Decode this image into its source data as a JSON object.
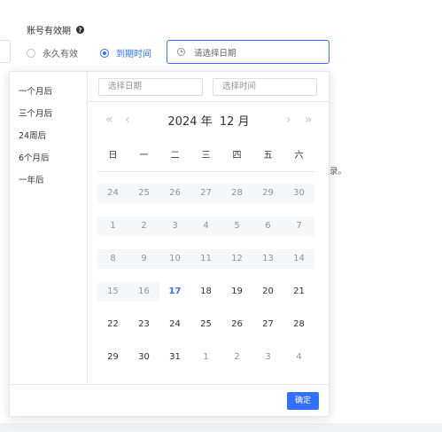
{
  "form": {
    "label": "账号有效期",
    "help_glyph": "?",
    "radio_forever": "永久有效",
    "radio_expiry": "到期时间",
    "date_placeholder": "请选择日期",
    "bg_text": "录。"
  },
  "picker": {
    "shortcuts": [
      "一个月后",
      "三个月后",
      "24周后",
      "6个月后",
      "一年后"
    ],
    "date_placeholder": "选择日期",
    "time_placeholder": "选择时间",
    "nav": {
      "prev_year": "«",
      "prev_month": "‹",
      "next_month": "›",
      "next_year": "»"
    },
    "title_year": "2024 年",
    "title_month": "12 月",
    "weekdays": [
      "日",
      "一",
      "二",
      "三",
      "四",
      "五",
      "六"
    ],
    "weeks": [
      [
        {
          "d": "24",
          "s": "disabled"
        },
        {
          "d": "25",
          "s": "disabled"
        },
        {
          "d": "26",
          "s": "disabled"
        },
        {
          "d": "27",
          "s": "disabled"
        },
        {
          "d": "28",
          "s": "disabled"
        },
        {
          "d": "29",
          "s": "disabled"
        },
        {
          "d": "30",
          "s": "disabled"
        }
      ],
      [
        {
          "d": "1",
          "s": "disabled"
        },
        {
          "d": "2",
          "s": "disabled"
        },
        {
          "d": "3",
          "s": "disabled"
        },
        {
          "d": "4",
          "s": "disabled"
        },
        {
          "d": "5",
          "s": "disabled"
        },
        {
          "d": "6",
          "s": "disabled"
        },
        {
          "d": "7",
          "s": "disabled"
        }
      ],
      [
        {
          "d": "8",
          "s": "disabled"
        },
        {
          "d": "9",
          "s": "disabled"
        },
        {
          "d": "10",
          "s": "disabled"
        },
        {
          "d": "11",
          "s": "disabled"
        },
        {
          "d": "12",
          "s": "disabled"
        },
        {
          "d": "13",
          "s": "disabled"
        },
        {
          "d": "14",
          "s": "disabled"
        }
      ],
      [
        {
          "d": "15",
          "s": "disabled"
        },
        {
          "d": "16",
          "s": "disabled"
        },
        {
          "d": "17",
          "s": "today"
        },
        {
          "d": "18",
          "s": "normal"
        },
        {
          "d": "19",
          "s": "normal"
        },
        {
          "d": "20",
          "s": "normal"
        },
        {
          "d": "21",
          "s": "normal"
        }
      ],
      [
        {
          "d": "22",
          "s": "normal"
        },
        {
          "d": "23",
          "s": "normal"
        },
        {
          "d": "24",
          "s": "normal"
        },
        {
          "d": "25",
          "s": "normal"
        },
        {
          "d": "26",
          "s": "normal"
        },
        {
          "d": "27",
          "s": "normal"
        },
        {
          "d": "28",
          "s": "normal"
        }
      ],
      [
        {
          "d": "29",
          "s": "normal"
        },
        {
          "d": "30",
          "s": "normal"
        },
        {
          "d": "31",
          "s": "normal"
        },
        {
          "d": "1",
          "s": "next"
        },
        {
          "d": "2",
          "s": "next"
        },
        {
          "d": "3",
          "s": "next"
        },
        {
          "d": "4",
          "s": "next"
        }
      ]
    ],
    "confirm_label": "确定"
  },
  "colors": {
    "accent": "#3370ff",
    "disabled_bg": "#f5f7fa",
    "muted": "#909399"
  }
}
